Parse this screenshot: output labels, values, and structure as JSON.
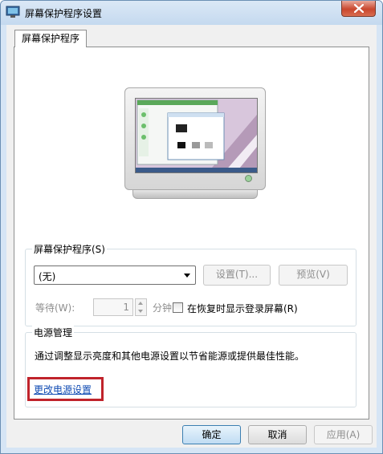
{
  "window": {
    "title": "屏幕保护程序设置",
    "close_glyph": "x"
  },
  "tab": {
    "label": "屏幕保护程序"
  },
  "screensaver": {
    "group_label": "屏幕保护程序(S)",
    "selected": "(无)",
    "settings_button": "设置(T)...",
    "preview_button": "预览(V)",
    "wait_label": "等待(W):",
    "wait_value": "1",
    "wait_unit": "分钟",
    "resume_checkbox_label": "在恢复时显示登录屏幕(R)",
    "resume_checked": false
  },
  "power": {
    "group_label": "电源管理",
    "description": "通过调整显示亮度和其他电源设置以节省能源或提供最佳性能。",
    "link": "更改电源设置"
  },
  "buttons": {
    "ok": "确定",
    "cancel": "取消",
    "apply": "应用(A)"
  },
  "colors": {
    "highlight_box": "#c0232b",
    "link": "#0f4bb3",
    "titlebar": "#c4d9ef"
  }
}
